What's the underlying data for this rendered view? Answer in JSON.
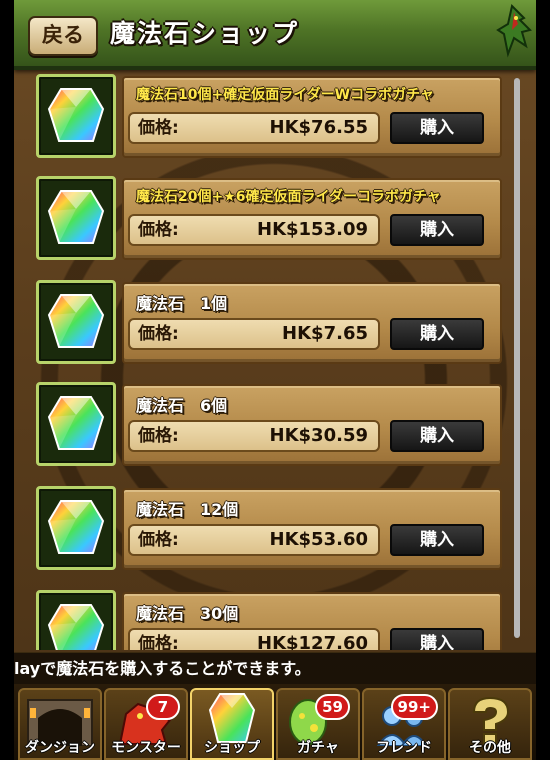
{
  "header": {
    "back_label": "戻る",
    "title": "魔法石ショップ"
  },
  "products": [
    {
      "name": "魔法石10個+確定仮面ライダーWコラボガチャ",
      "price_label": "価格:",
      "price": "HK$76.55",
      "buy_label": "購入"
    },
    {
      "name": "魔法石20個+★6確定仮面ライダーコラボガチャ",
      "price_label": "価格:",
      "price": "HK$153.09",
      "buy_label": "購入"
    },
    {
      "name": "魔法石　1個",
      "price_label": "価格:",
      "price": "HK$7.65",
      "buy_label": "購入"
    },
    {
      "name": "魔法石　6個",
      "price_label": "価格:",
      "price": "HK$30.59",
      "buy_label": "購入"
    },
    {
      "name": "魔法石　12個",
      "price_label": "価格:",
      "price": "HK$53.60",
      "buy_label": "購入"
    },
    {
      "name": "魔法石　30個",
      "price_label": "価格:",
      "price": "HK$127.60",
      "buy_label": "購入"
    }
  ],
  "info": {
    "text": "layで魔法石を購入することができます。"
  },
  "nav": [
    {
      "label": "ダンジョン",
      "icon": "dungeon-gate-icon",
      "badge": ""
    },
    {
      "label": "モンスター",
      "icon": "red-dragon-icon",
      "badge": "7"
    },
    {
      "label": "ショップ",
      "icon": "magic-stone-icon",
      "badge": ""
    },
    {
      "label": "ガチャ",
      "icon": "egg-icon",
      "badge": "59"
    },
    {
      "label": "フレンド",
      "icon": "friends-icon",
      "badge": "99+"
    },
    {
      "label": "その他",
      "icon": "question-mark-icon",
      "badge": ""
    }
  ],
  "colors": {
    "header_green": "#4f7426",
    "panel_wood": "#b48a4a",
    "gold_title": "#ffe84a",
    "buy_button": "#161616",
    "badge_red": "#d11a1a"
  }
}
